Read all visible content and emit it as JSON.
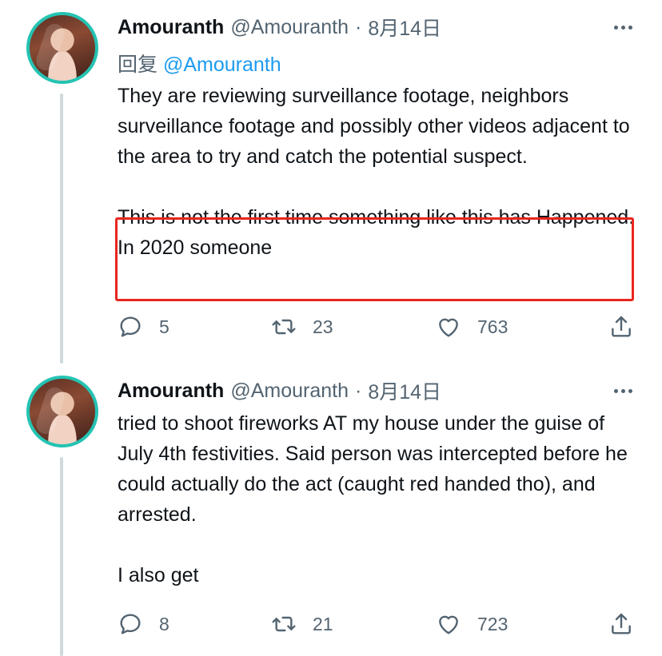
{
  "tweets": [
    {
      "name": "Amouranth",
      "handle": "@Amouranth",
      "separator": "·",
      "date": "8月14日",
      "reply_prefix": "回复",
      "reply_mention": "@Amouranth",
      "paragraphs": [
        "They are reviewing surveillance footage, neighbors surveillance footage and possibly other videos adjacent to the area to try and catch the potential suspect.",
        "This is not the first time something like this has Happened.  In 2020 someone"
      ],
      "replies": "5",
      "retweets": "23",
      "likes": "763"
    },
    {
      "name": "Amouranth",
      "handle": "@Amouranth",
      "separator": "·",
      "date": "8月14日",
      "paragraphs": [
        "tried to shoot fireworks AT my house under the guise of July 4th festivities.  Said person was intercepted before he could actually do the act (caught red handed tho), and arrested.",
        "I also get"
      ],
      "replies": "8",
      "retweets": "21",
      "likes": "723"
    }
  ],
  "icons": {
    "reply": "reply-icon",
    "retweet": "retweet-icon",
    "like": "heart-icon",
    "share": "share-icon",
    "more": "more-icon"
  },
  "colors": {
    "highlight_border": "#e8261e",
    "link": "#1d9bf0",
    "secondary_text": "#536471",
    "avatar_ring": "#25c3b2",
    "thread_line": "#cfd9de"
  }
}
